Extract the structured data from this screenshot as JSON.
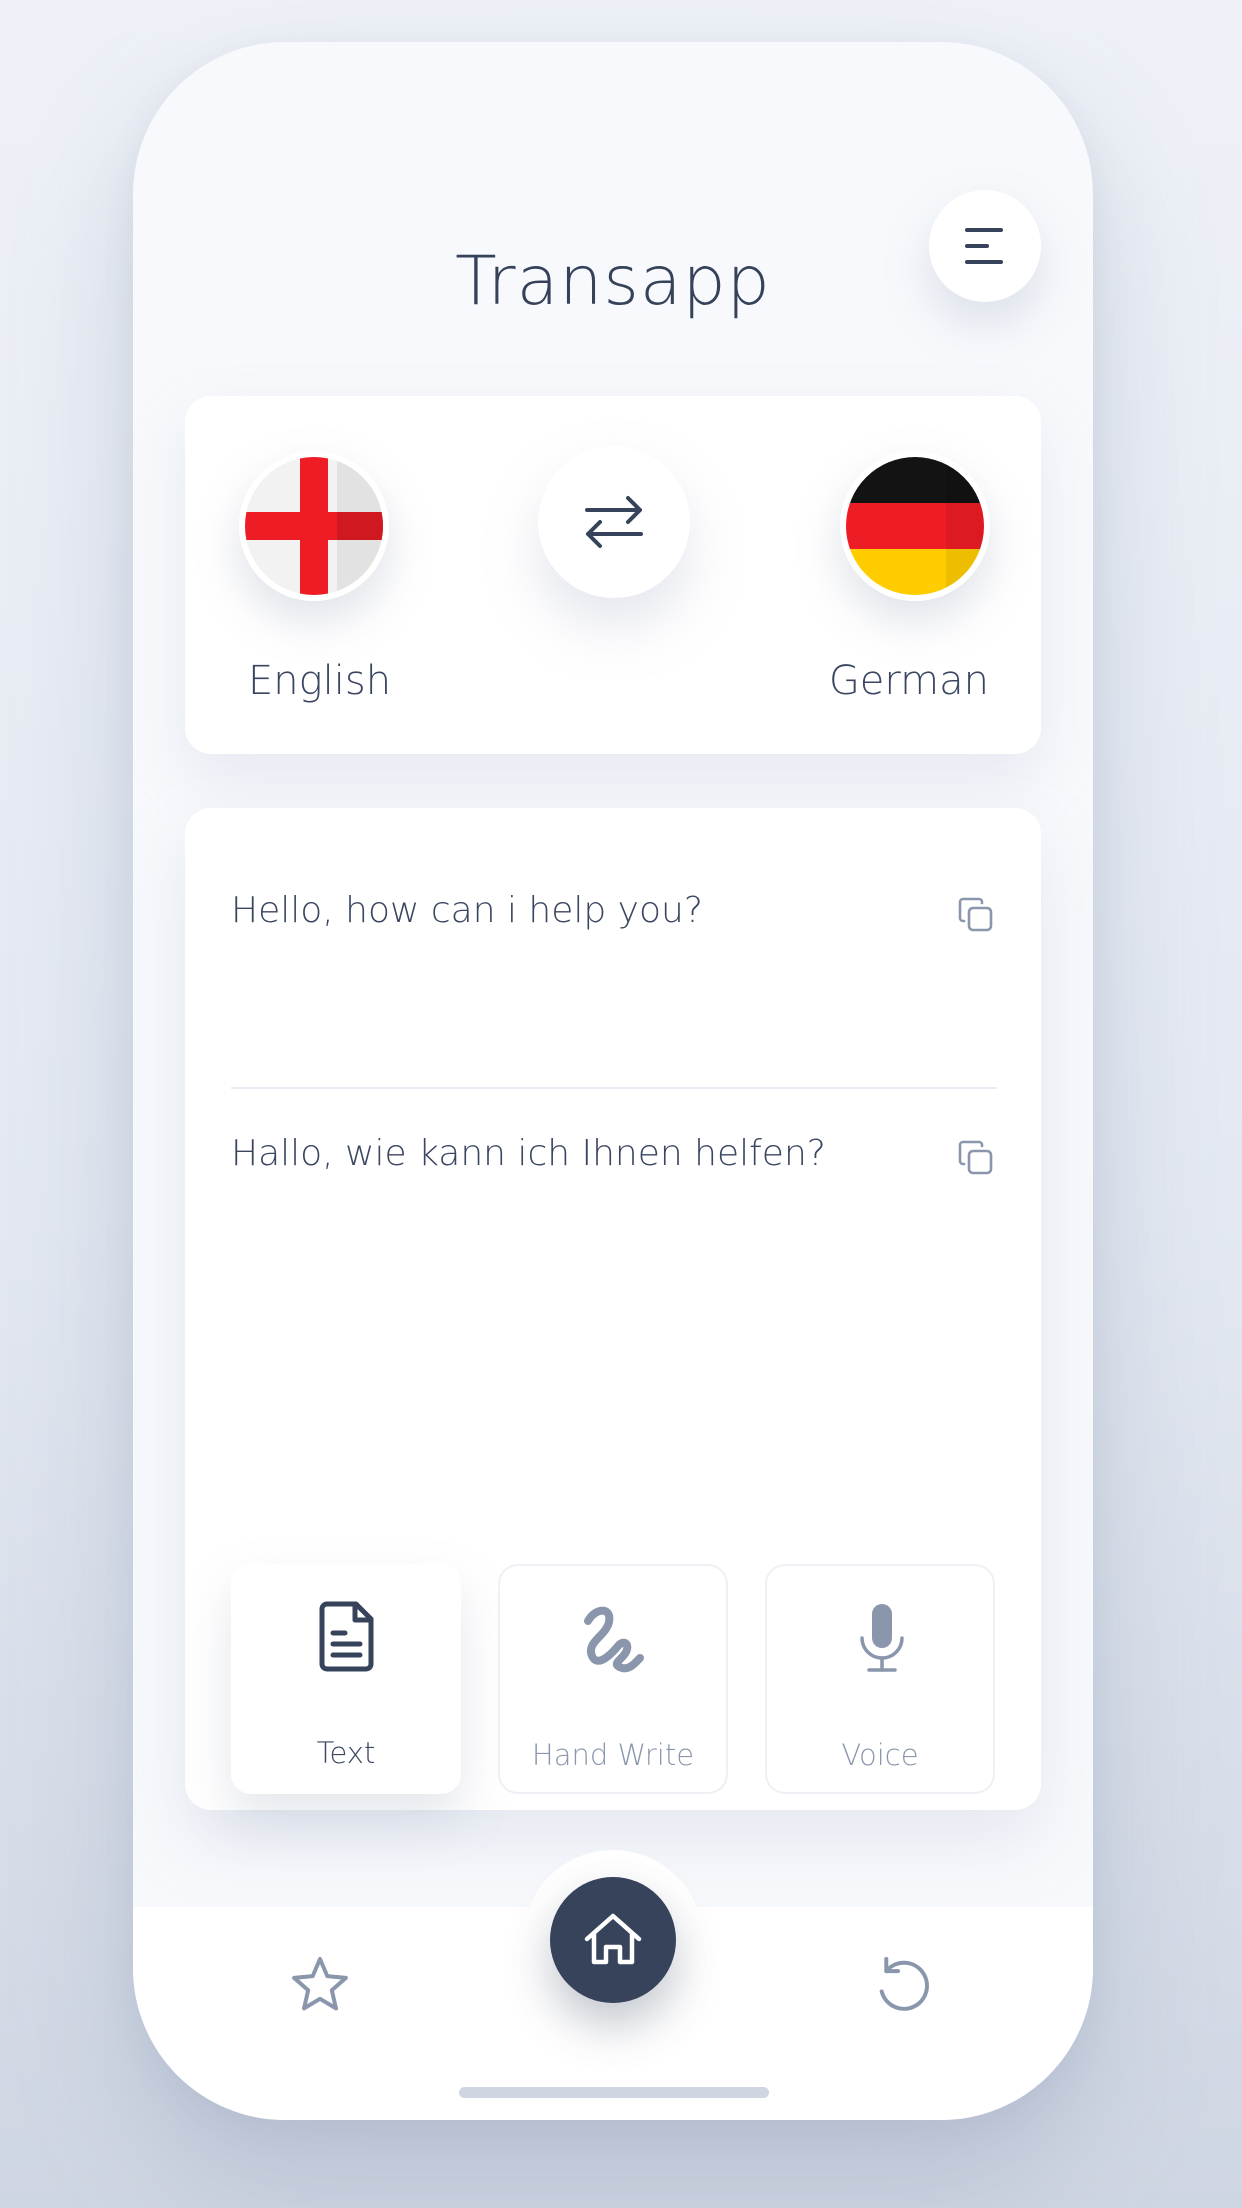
{
  "header": {
    "title": "Transapp",
    "menu_icon": "menu-icon"
  },
  "languages": {
    "source": {
      "name": "English",
      "flag_icon": "england-flag-icon"
    },
    "target": {
      "name": "German",
      "flag_icon": "germany-flag-icon"
    },
    "swap_icon": "swap-arrows-icon"
  },
  "translation": {
    "source_text": "Hello, how can i help you?",
    "target_text": "Hallo, wie kann ich Ihnen helfen?",
    "copy_icon": "copy-icon"
  },
  "input_modes": [
    {
      "label": "Text",
      "icon": "document-icon",
      "selected": true
    },
    {
      "label": "Hand Write",
      "icon": "handwriting-icon",
      "selected": false
    },
    {
      "label": "Voice",
      "icon": "microphone-icon",
      "selected": false
    }
  ],
  "bottom_nav": {
    "items": [
      {
        "icon": "star-icon",
        "selected": false
      },
      {
        "icon": "home-icon",
        "selected": true
      },
      {
        "icon": "history-icon",
        "selected": false
      }
    ]
  },
  "colors": {
    "primary_dark": "#36435a",
    "text": "#3a4660",
    "muted": "#8a96ac",
    "background": "#f7f9fc",
    "england_red": "#ee1c25",
    "germany_black": "#131313",
    "germany_red": "#ee1c25",
    "germany_gold": "#ffcc00"
  }
}
